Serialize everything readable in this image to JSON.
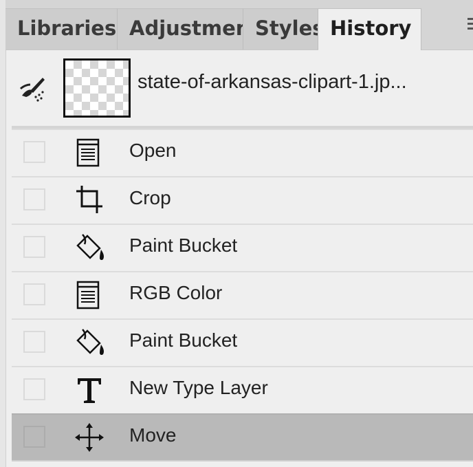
{
  "tabs": [
    {
      "label": "Libraries",
      "active": false
    },
    {
      "label": "Adjustments",
      "active": false
    },
    {
      "label": "Styles",
      "active": false
    },
    {
      "label": "History",
      "active": true
    }
  ],
  "snapshot": {
    "icon": "art-history-brush-icon",
    "filename": "state-of-arkansas-clipart-1.jp..."
  },
  "history": [
    {
      "label": "Open",
      "icon": "document-icon",
      "selected": false
    },
    {
      "label": "Crop",
      "icon": "crop-icon",
      "selected": false
    },
    {
      "label": "Paint Bucket",
      "icon": "paint-bucket-icon",
      "selected": false
    },
    {
      "label": "RGB Color",
      "icon": "document-icon",
      "selected": false
    },
    {
      "label": "Paint Bucket",
      "icon": "paint-bucket-icon",
      "selected": false
    },
    {
      "label": "New Type Layer",
      "icon": "type-tool-icon",
      "selected": false
    },
    {
      "label": "Move",
      "icon": "move-tool-icon",
      "selected": true
    }
  ],
  "colors": {
    "panel_bg": "#efefef",
    "tab_bg": "#cdcdcd",
    "selected_row_bg": "#b9b9b9"
  }
}
